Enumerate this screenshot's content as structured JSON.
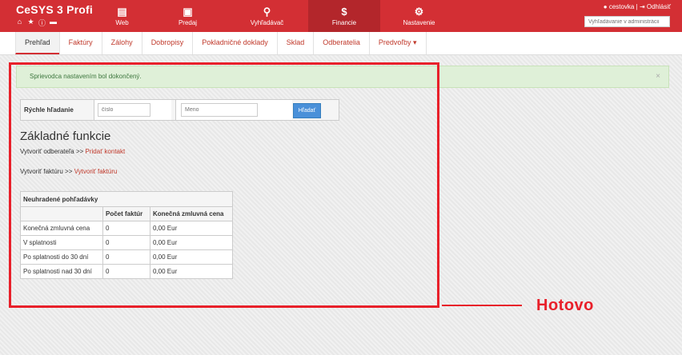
{
  "app": {
    "brand": "CeSYS 3 Profi",
    "brand_icons": [
      "home-icon",
      "star-icon",
      "info-icon",
      "chat-icon"
    ]
  },
  "nav_main": [
    {
      "label": "Web",
      "icon": "web-icon"
    },
    {
      "label": "Predaj",
      "icon": "briefcase-icon"
    },
    {
      "label": "Vyhľadávač",
      "icon": "search-icon"
    },
    {
      "label": "Financie",
      "icon": "dollar-icon",
      "active": true
    },
    {
      "label": "Nastavenie",
      "icon": "gear-icon"
    }
  ],
  "user": {
    "name": "cestovka",
    "separator": "|",
    "logout": "Odhlásiť",
    "search_placeholder": "Vyhľadávanie v administrácii"
  },
  "subnav": [
    {
      "label": "Prehľad",
      "active": true
    },
    {
      "label": "Faktúry"
    },
    {
      "label": "Zálohy"
    },
    {
      "label": "Dobropisy"
    },
    {
      "label": "Pokladničné doklady"
    },
    {
      "label": "Sklad"
    },
    {
      "label": "Odberatelia"
    },
    {
      "label": "Predvoľby ▾"
    }
  ],
  "alert": {
    "text": "Sprievodca nastavením bol dokončený.",
    "close": "×"
  },
  "quick_search": {
    "label": "Rýchle hľadanie",
    "number_placeholder": "číslo",
    "name_placeholder": "Meno",
    "button": "Hľadať"
  },
  "basic": {
    "title": "Základné funkcie",
    "line1_text": "Vytvoriť odberateľa >> ",
    "line1_link": "Pridať kontakt",
    "line2_text": "Vytvoriť faktúru >> ",
    "line2_link": "Vytvoriť faktúru"
  },
  "receivables": {
    "caption": "Neuhradené pohľadávky",
    "headers": [
      "",
      "Počet faktúr",
      "Konečná zmluvná cena"
    ],
    "rows": [
      [
        "Konečná zmluvná cena",
        "0",
        "0,00 Eur"
      ],
      [
        "V splatnosti",
        "0",
        "0,00 Eur"
      ],
      [
        "Po splatnosti do 30 dní",
        "0",
        "0,00 Eur"
      ],
      [
        "Po splatnosti nad 30 dní",
        "0",
        "0,00 Eur"
      ]
    ]
  },
  "annotation": {
    "label": "Hotovo",
    "color": "#e8202a"
  },
  "colors": {
    "brand": "#d32f34",
    "active_nav": "#b3262b",
    "link": "#c0392b",
    "button": "#4a90d9",
    "alert_bg": "#dff0d8"
  }
}
